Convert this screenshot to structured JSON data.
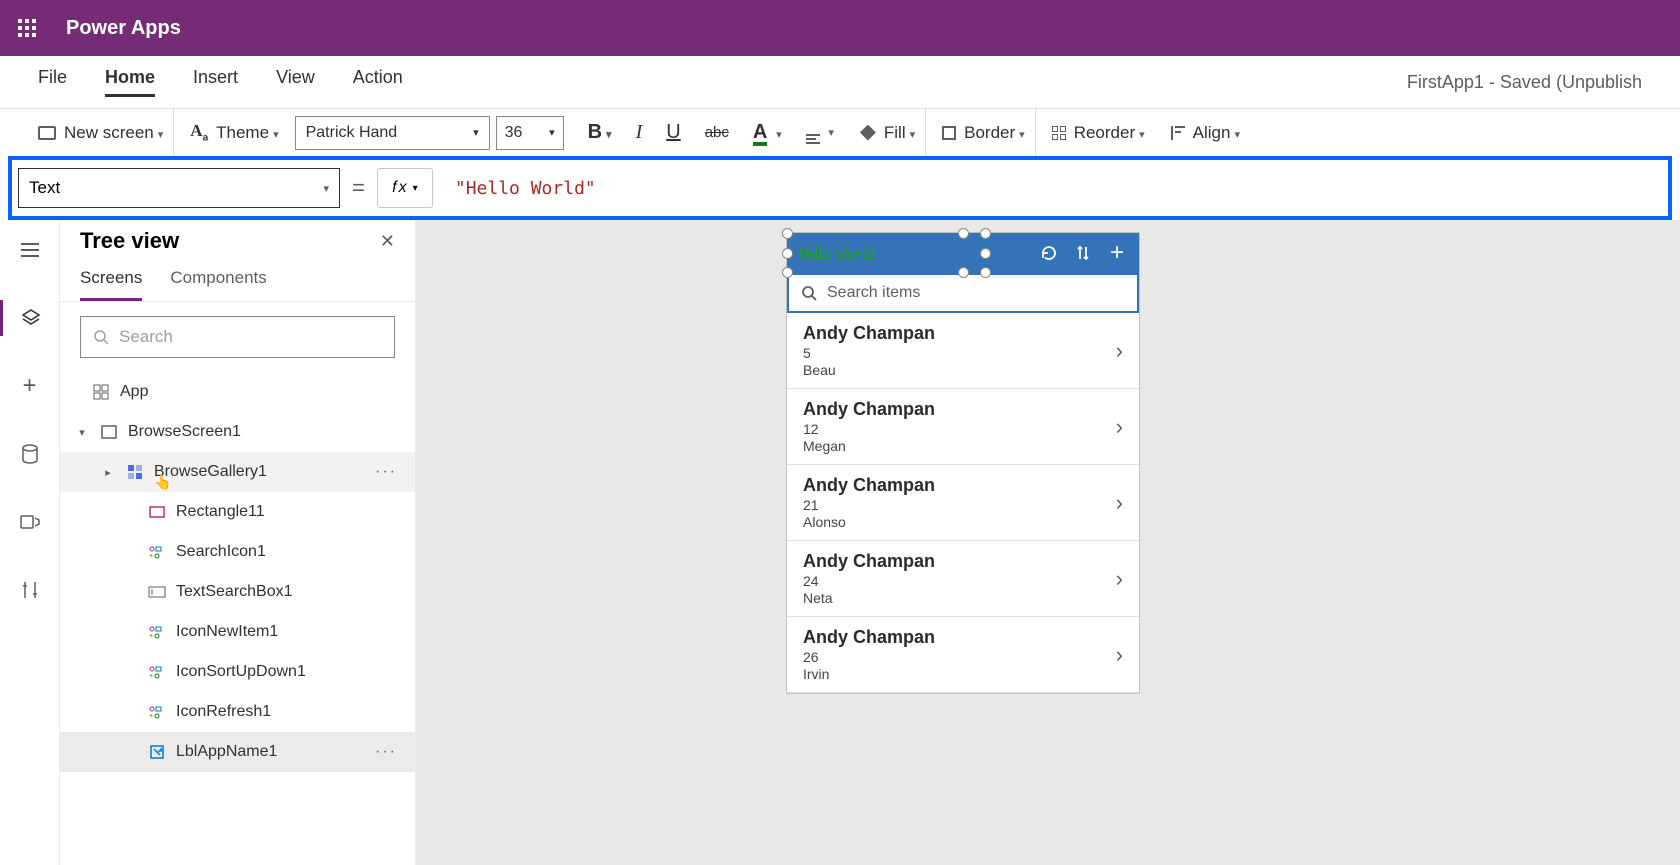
{
  "app_title": "Power Apps",
  "menubar": {
    "items": [
      "File",
      "Home",
      "Insert",
      "View",
      "Action"
    ],
    "active_index": 1,
    "right_status": "FirstApp1 - Saved (Unpublish"
  },
  "toolbar": {
    "new_screen": "New screen",
    "theme": "Theme",
    "font_name": "Patrick Hand",
    "font_size": "36",
    "fill": "Fill",
    "border": "Border",
    "reorder": "Reorder",
    "align": "Align"
  },
  "formula": {
    "property": "Text",
    "value": "\"Hello World\""
  },
  "tree": {
    "title": "Tree view",
    "tabs": [
      "Screens",
      "Components"
    ],
    "active_tab": 0,
    "search_placeholder": "Search",
    "root_label": "App",
    "items": [
      {
        "label": "BrowseScreen1",
        "level": 0,
        "icon": "screen",
        "expanded": true
      },
      {
        "label": "BrowseGallery1",
        "level": 1,
        "icon": "gallery",
        "hover": true,
        "more": true,
        "chev": true
      },
      {
        "label": "Rectangle11",
        "level": 2,
        "icon": "rect"
      },
      {
        "label": "SearchIcon1",
        "level": 2,
        "icon": "group"
      },
      {
        "label": "TextSearchBox1",
        "level": 2,
        "icon": "textbox"
      },
      {
        "label": "IconNewItem1",
        "level": 2,
        "icon": "group"
      },
      {
        "label": "IconSortUpDown1",
        "level": 2,
        "icon": "group"
      },
      {
        "label": "IconRefresh1",
        "level": 2,
        "icon": "group"
      },
      {
        "label": "LblAppName1",
        "level": 2,
        "icon": "label",
        "selected": true,
        "more": true
      }
    ]
  },
  "phone": {
    "header_title": "Hello World",
    "search_placeholder": "Search items",
    "gallery": [
      {
        "name": "Andy Champan",
        "n": "5",
        "sub": "Beau"
      },
      {
        "name": "Andy Champan",
        "n": "12",
        "sub": "Megan"
      },
      {
        "name": "Andy Champan",
        "n": "21",
        "sub": "Alonso"
      },
      {
        "name": "Andy Champan",
        "n": "24",
        "sub": "Neta"
      },
      {
        "name": "Andy Champan",
        "n": "26",
        "sub": "Irvin"
      }
    ]
  }
}
